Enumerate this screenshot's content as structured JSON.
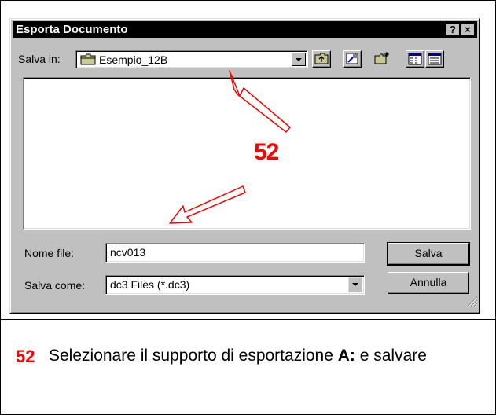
{
  "dialog": {
    "title": "Esporta Documento",
    "help_glyph": "?",
    "close_glyph": "×",
    "save_in_label": "Salva in:",
    "save_in_value": "Esempio_12B",
    "toolbar": [
      "up-folder-icon",
      "desktop-icon",
      "new-folder-icon",
      "list-view-icon",
      "details-view-icon"
    ],
    "file_name_label": "Nome file:",
    "file_name_value": "ncv013",
    "save_as_label": "Salva come:",
    "save_as_value": "dc3 Files (*.dc3)",
    "save_button": "Salva",
    "cancel_button": "Annulla"
  },
  "annotation": {
    "callout_number": "52",
    "arrow_color": "#ff0000"
  },
  "caption": {
    "number": "52",
    "text_before": "Selezionare il supporto di esportazione ",
    "text_bold": "A:",
    "text_after": " e salvare"
  }
}
